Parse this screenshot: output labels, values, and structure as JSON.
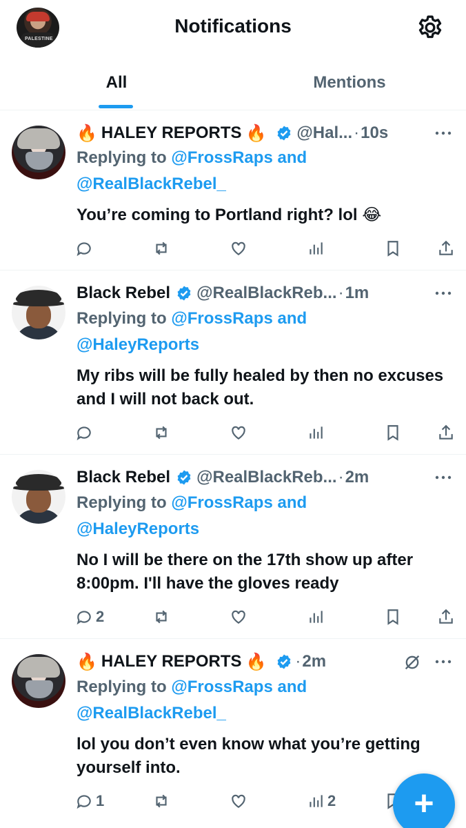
{
  "header": {
    "title": "Notifications",
    "avatar_shirt_text": "PALESTINE"
  },
  "tabs": [
    {
      "label": "All",
      "active": true
    },
    {
      "label": "Mentions",
      "active": false
    }
  ],
  "tweets": [
    {
      "name": "HALEY REPORTS",
      "name_emoji_before": "🔥",
      "name_emoji_after": "🔥",
      "verified": true,
      "handle": "@Hal...",
      "time": "10s",
      "reply_prefix": "Replying to",
      "reply_to_1": "@FrossRaps",
      "reply_and": "and",
      "reply_to_2": "@RealBlackRebel_",
      "text": "You’re coming to Portland right? lol 😂",
      "replies": "",
      "views": "",
      "avatar": "haley"
    },
    {
      "name": "Black Rebel",
      "verified": true,
      "handle": "@RealBlackReb...",
      "time": "1m",
      "reply_prefix": "Replying to",
      "reply_to_1": "@FrossRaps",
      "reply_and": "and",
      "reply_to_2": "@HaleyReports",
      "text": "My ribs will be fully healed by then no excuses and I will not back out.",
      "replies": "",
      "views": "",
      "avatar": "rebel"
    },
    {
      "name": "Black Rebel",
      "verified": true,
      "handle": "@RealBlackReb...",
      "time": "2m",
      "reply_prefix": "Replying to",
      "reply_to_1": "@FrossRaps",
      "reply_and": "and",
      "reply_to_2": "@HaleyReports",
      "text": "No I will be there on the 17th show up after 8:00pm. I'll have the gloves ready",
      "replies": "2",
      "views": "",
      "avatar": "rebel"
    },
    {
      "name": "HALEY REPORTS",
      "name_emoji_before": "🔥",
      "name_emoji_after": "🔥",
      "verified": true,
      "handle": "",
      "time": "2m",
      "reply_prefix": "Replying to",
      "reply_to_1": "@FrossRaps",
      "reply_and": "and",
      "reply_to_2": "@RealBlackRebel_",
      "text": "lol you don’t even know what you’re getting yourself into.",
      "replies": "1",
      "views": "2",
      "avatar": "haley"
    }
  ],
  "fab_label": "+",
  "colors": {
    "accent": "#1d9bf0",
    "text": "#0f1419",
    "secondary": "#536471",
    "divider": "#eff3f4"
  },
  "icons": [
    "gear-icon",
    "verified-badge-icon",
    "more-icon",
    "reply-icon",
    "retweet-icon",
    "like-icon",
    "views-icon",
    "bookmark-icon",
    "share-icon",
    "mute-icon",
    "compose-icon"
  ]
}
